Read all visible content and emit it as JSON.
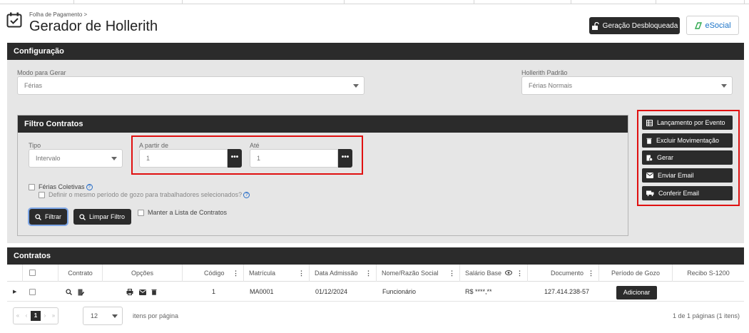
{
  "header": {
    "breadcrumb": "Folha de Pagamento  >",
    "title": "Gerador de Hollerith",
    "gen_button": "Geração Desbloqueada",
    "esocial_button": "eSocial"
  },
  "config": {
    "section_title": "Configuração",
    "modo_label": "Modo para Gerar",
    "modo_value": "Férias",
    "hollerith_label": "Hollerith Padrão",
    "hollerith_value": "Férias Normais"
  },
  "filtro": {
    "section_title": "Filtro Contratos",
    "tipo_label": "Tipo",
    "tipo_value": "Intervalo",
    "apartir_label": "A partir de",
    "apartir_value": "1",
    "ate_label": "Até",
    "ate_value": "1",
    "dots": "•••",
    "ferias_coletivas": "Férias Coletivas",
    "definir_periodo": "Definir o mesmo período de gozo para trabalhadores selecionados?",
    "filtrar_button": "Filtrar",
    "limpar_button": "Limpar Filtro",
    "manter_lista": "Manter a Lista de Contratos"
  },
  "actions": {
    "lancamento": "Lançamento por Evento",
    "excluir": "Excluir Movimentação",
    "gerar": "Gerar",
    "enviar_email": "Enviar Email",
    "conferir_email": "Conferir Email"
  },
  "contratos": {
    "section_title": "Contratos",
    "columns": {
      "contrato": "Contrato",
      "opcoes": "Opções",
      "codigo": "Código",
      "matricula": "Matrícula",
      "data_admissao": "Data Admissão",
      "nome": "Nome/Razão Social",
      "salario": "Salário Base",
      "documento": "Documento",
      "periodo": "Período de Gozo",
      "recibo": "Recibo S-1200"
    },
    "row": {
      "codigo": "1",
      "matricula": "MA0001",
      "data_admissao": "01/12/2024",
      "nome": "Funcionário",
      "salario": "R$ ****,**",
      "documento": "127.414.238-57",
      "adicionar": "Adicionar"
    },
    "pager": {
      "current_page": "1",
      "per_page": "12",
      "per_page_label": "itens por página",
      "summary": "1 de 1 páginas (1 itens)"
    }
  },
  "colors": {
    "dark": "#2b2b2b",
    "highlight": "#e01010",
    "panel": "#e6e6e6"
  }
}
